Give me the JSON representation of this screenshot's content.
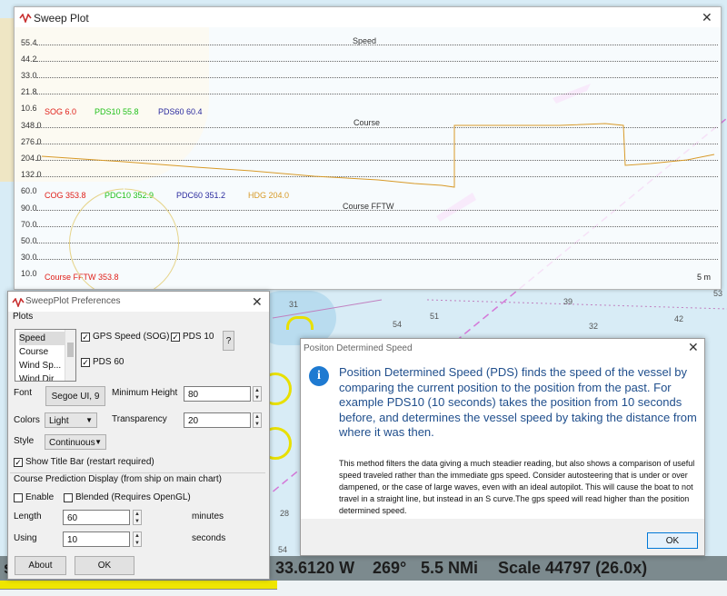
{
  "sweep_plot": {
    "title": "Sweep Plot",
    "lanes": {
      "speed": {
        "title": "Speed",
        "y_labels": [
          "55.4",
          "44.2",
          "33.0",
          "21.8",
          "10.6"
        ],
        "values": {
          "sog": "SOG  6.0",
          "pds10": "PDS10 55.8",
          "pds60": "PDS60 60.4"
        }
      },
      "course": {
        "title": "Course",
        "y_labels": [
          "348.0",
          "276.0",
          "204.0",
          "132.0",
          "60.0"
        ],
        "values": {
          "cog": "COG 353.8",
          "pdc10": "PDC10 352.9",
          "pdc60": "PDC60 351.2",
          "hdg": "HDG 204.0"
        }
      },
      "course_fftw": {
        "title": "Course FFTW",
        "y_labels": [
          "90.0",
          "70.0",
          "50.0",
          "30.0",
          "10.0"
        ],
        "values": {
          "course_fftw": "Course FFTW 353.8"
        }
      }
    },
    "time_span": "5 m",
    "colors": {
      "sog": "#e0201a",
      "pds10": "#22c11b",
      "pds60": "#2a2a9e",
      "hdg": "#d89a28",
      "course_fftw": "#e0201a"
    }
  },
  "preferences": {
    "title": "SweepPlot Preferences",
    "plots_label": "Plots",
    "plot_list": [
      "Speed",
      "Course",
      "Wind Sp...",
      "Wind Dir"
    ],
    "checkboxes": {
      "gps_speed": "GPS Speed (SOG)",
      "pds10": "PDS 10",
      "pds60": "PDS 60"
    },
    "help_button": "?",
    "font_label": "Font",
    "font_button": "Segoe UI, 9",
    "min_height_label": "Minimum Height",
    "min_height_value": "80",
    "colors_label": "Colors",
    "colors_value": "Light",
    "transparency_label": "Transparency",
    "transparency_value": "20",
    "style_label": "Style",
    "style_value": "Continuous",
    "show_title_bar": "Show Title Bar (restart required)",
    "course_prediction_label": "Course Prediction Display (from ship on main chart)",
    "enable": "Enable",
    "blended": "Blended (Requires OpenGL)",
    "length_label": "Length",
    "length_value": "60",
    "length_units": "minutes",
    "using_label": "Using",
    "using_value": "10",
    "using_units": "seconds",
    "about_button": "About",
    "ok_button": "OK"
  },
  "info_dialog": {
    "title": "Positon Determined Speed",
    "main_text": "Position Determined Speed (PDS) finds the speed of the vessel by comparing the current position to the position from the past.  For example PDS10 (10 seconds) takes the position from 10 seconds before, and determines the vessel speed by taking the distance from where it was then.",
    "detail_text": "This method filters the data giving a much steadier reading, but also shows a comparison of useful speed traveled rather than the immediate gps speed.  Consider autosteering that is under or over dampened, or the case of large waves, even with an ideal autopilot. This will cause the boat to not travel in a straight line, but instead in an S curve.The gps speed will read higher than the position determined speed.",
    "ok_button": "OK"
  },
  "status_bar": {
    "longitude": "33.6120 W",
    "cog": "269°",
    "distance": "5.5 NMi",
    "scale": "Scale  44797 (26.0x)"
  },
  "chart_depths": [
    "39",
    "51",
    "54",
    "32",
    "42",
    "53",
    "31",
    "28",
    "54"
  ]
}
